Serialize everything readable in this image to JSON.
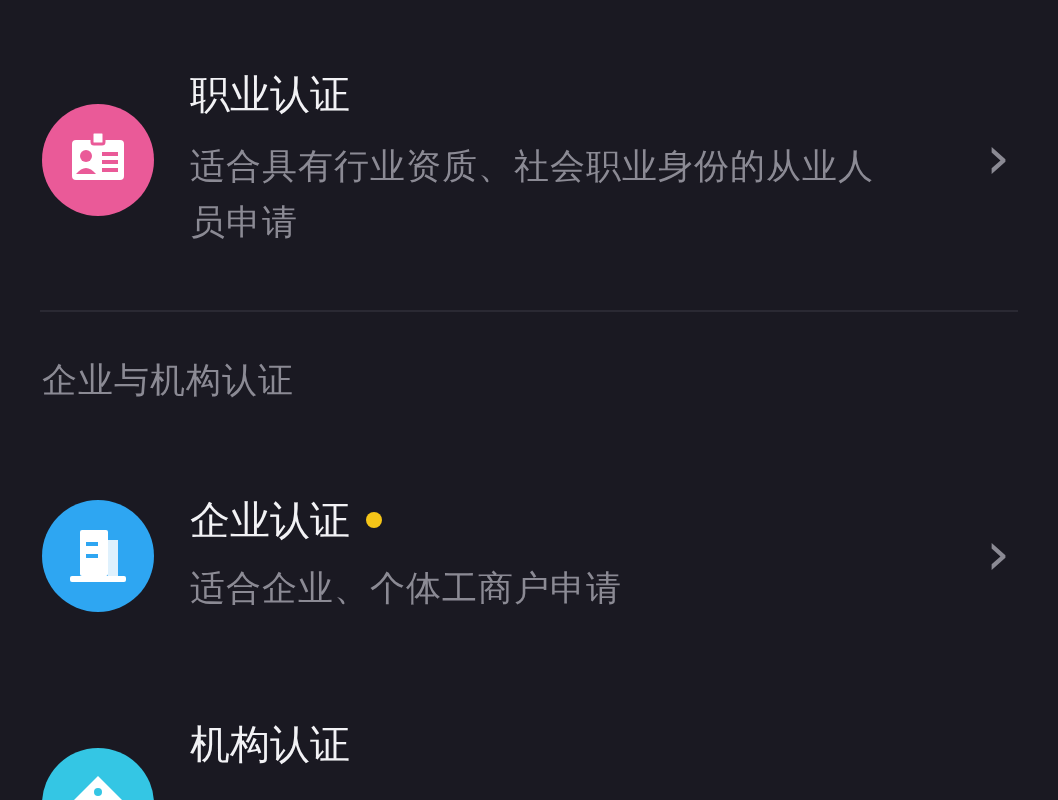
{
  "personal": [
    {
      "kind": "profession",
      "title": "职业认证",
      "description": "适合具有行业资质、社会职业身份的从业人员申请",
      "color": "#ea5a98",
      "new_dot": false,
      "chevron": "›"
    }
  ],
  "section_header": "企业与机构认证",
  "organization": [
    {
      "kind": "enterprise",
      "title": "企业认证",
      "description": "适合企业、个体工商户申请",
      "color": "#2ea6f2",
      "new_dot": true,
      "chevron": "›"
    },
    {
      "kind": "institution",
      "title": "机构认证",
      "color": "#34c6e4",
      "new_dot": false
    }
  ]
}
